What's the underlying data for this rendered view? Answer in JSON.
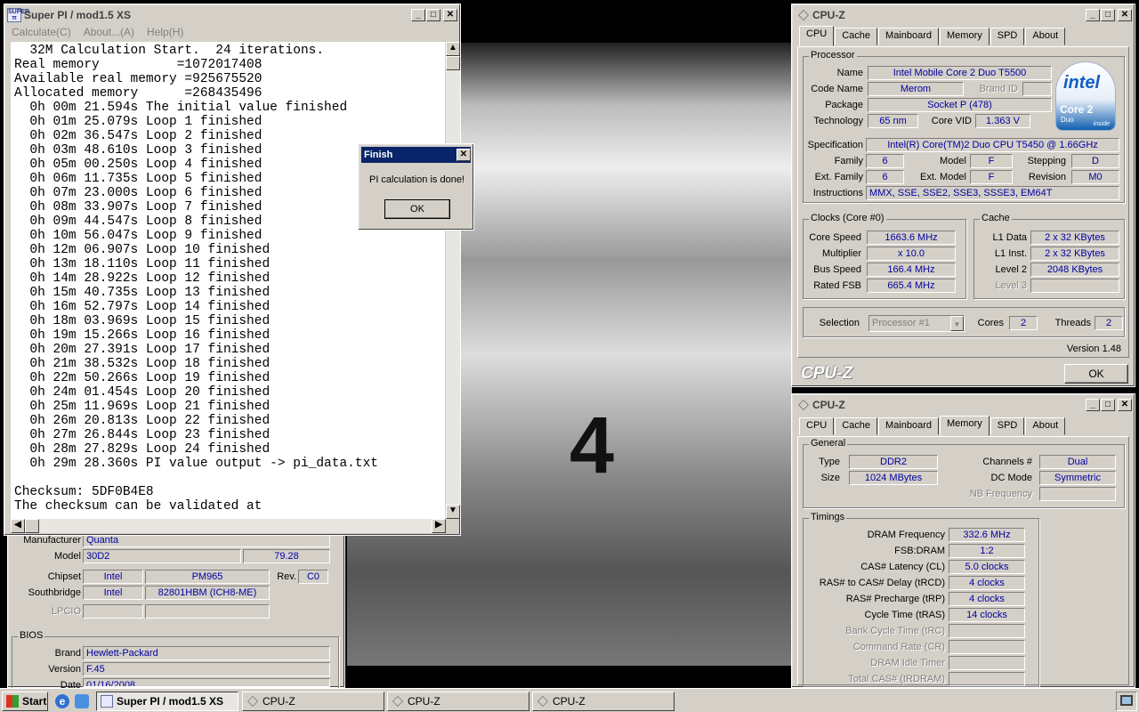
{
  "superpi": {
    "title": "Super PI / mod1.5 XS",
    "menu": [
      "Calculate(C)",
      "About...(A)",
      "Help(H)"
    ],
    "console_lines": [
      "  32M Calculation Start.  24 iterations.",
      "Real memory          =1072017408",
      "Available real memory =925675520",
      "Allocated memory      =268435496",
      "  0h 00m 21.594s The initial value finished",
      "  0h 01m 25.079s Loop 1 finished",
      "  0h 02m 36.547s Loop 2 finished",
      "  0h 03m 48.610s Loop 3 finished",
      "  0h 05m 00.250s Loop 4 finished",
      "  0h 06m 11.735s Loop 5 finished",
      "  0h 07m 23.000s Loop 6 finished",
      "  0h 08m 33.907s Loop 7 finished",
      "  0h 09m 44.547s Loop 8 finished",
      "  0h 10m 56.047s Loop 9 finished",
      "  0h 12m 06.907s Loop 10 finished",
      "  0h 13m 18.110s Loop 11 finished",
      "  0h 14m 28.922s Loop 12 finished",
      "  0h 15m 40.735s Loop 13 finished",
      "  0h 16m 52.797s Loop 14 finished",
      "  0h 18m 03.969s Loop 15 finished",
      "  0h 19m 15.266s Loop 16 finished",
      "  0h 20m 27.391s Loop 17 finished",
      "  0h 21m 38.532s Loop 18 finished",
      "  0h 22m 50.266s Loop 19 finished",
      "  0h 24m 01.454s Loop 20 finished",
      "  0h 25m 11.969s Loop 21 finished",
      "  0h 26m 20.813s Loop 22 finished",
      "  0h 27m 26.844s Loop 23 finished",
      "  0h 28m 27.829s Loop 24 finished",
      "  0h 29m 28.360s PI value output -> pi_data.txt",
      "",
      "Checksum: 5DF0B4E8",
      "The checksum can be validated at"
    ]
  },
  "finish_dialog": {
    "title": "Finish",
    "message": "PI calculation is done!",
    "ok": "OK"
  },
  "cpuz_mb": {
    "manufacturer_label": "Manufacturer",
    "manufacturer": "Quanta",
    "model_label": "Model",
    "model": "30D2",
    "model_rev": "79.28",
    "chipset_label": "Chipset",
    "chipset_vendor": "Intel",
    "chipset_name": "PM965",
    "rev_label": "Rev.",
    "chipset_rev": "C0",
    "southbridge_label": "Southbridge",
    "sb_vendor": "Intel",
    "sb_name": "82801HBM (ICH8-ME)",
    "lpcio_label": "LPCIO",
    "bios_title": "BIOS",
    "brand_label": "Brand",
    "brand": "Hewlett-Packard",
    "version_label": "Version",
    "version": "F.45",
    "date_label": "Date",
    "date": "01/16/2008"
  },
  "cpuz_cpu": {
    "title": "CPU-Z",
    "tabs": [
      "CPU",
      "Cache",
      "Mainboard",
      "Memory",
      "SPD",
      "About"
    ],
    "processor_title": "Processor",
    "name_label": "Name",
    "name": "Intel Mobile Core 2 Duo T5500",
    "codename_label": "Code Name",
    "codename": "Merom",
    "brandid_label": "Brand ID",
    "package_label": "Package",
    "package": "Socket P (478)",
    "technology_label": "Technology",
    "technology": "65 nm",
    "corevid_label": "Core VID",
    "corevid": "1.363 V",
    "spec_label": "Specification",
    "spec": "Intel(R) Core(TM)2 Duo CPU     T5450  @ 1.66GHz",
    "family_label": "Family",
    "family": "6",
    "model_label": "Model",
    "model": "F",
    "stepping_label": "Stepping",
    "stepping": "D",
    "extfamily_label": "Ext. Family",
    "extfamily": "6",
    "extmodel_label": "Ext. Model",
    "extmodel": "F",
    "revision_label": "Revision",
    "revision": "M0",
    "instr_label": "Instructions",
    "instr": "MMX, SSE, SSE2, SSE3, SSSE3, EM64T",
    "clocks_title": "Clocks (Core #0)",
    "corespeed_label": "Core Speed",
    "corespeed": "1663.6 MHz",
    "multiplier_label": "Multiplier",
    "multiplier": "x 10.0",
    "busspeed_label": "Bus Speed",
    "busspeed": "166.4 MHz",
    "ratedfsb_label": "Rated FSB",
    "ratedfsb": "665.4 MHz",
    "cache_title": "Cache",
    "l1d_label": "L1 Data",
    "l1d": "2 x 32 KBytes",
    "l1i_label": "L1 Inst.",
    "l1i": "2 x 32 KBytes",
    "l2_label": "Level 2",
    "l2": "2048 KBytes",
    "l3_label": "Level 3",
    "selection_label": "Selection",
    "selection": "Processor #1",
    "cores_label": "Cores",
    "cores": "2",
    "threads_label": "Threads",
    "threads": "2",
    "version": "Version 1.48",
    "logo": "CPU-Z",
    "ok": "OK",
    "intel_logo": "intel",
    "core2_logo": "Core 2",
    "duo_logo": "Duo",
    "inside_logo": "inside"
  },
  "cpuz_mem": {
    "title": "CPU-Z",
    "tabs": [
      "CPU",
      "Cache",
      "Mainboard",
      "Memory",
      "SPD",
      "About"
    ],
    "general_title": "General",
    "type_label": "Type",
    "type": "DDR2",
    "channels_label": "Channels #",
    "channels": "Dual",
    "size_label": "Size",
    "size": "1024 MBytes",
    "dcmode_label": "DC Mode",
    "dcmode": "Symmetric",
    "nbfreq_label": "NB Frequency",
    "timings_title": "Timings",
    "dram_freq_label": "DRAM Frequency",
    "dram_freq": "332.6 MHz",
    "fsbdram_label": "FSB:DRAM",
    "fsbdram": "1:2",
    "cas_label": "CAS# Latency (CL)",
    "cas": "5.0 clocks",
    "trcd_label": "RAS# to CAS# Delay (tRCD)",
    "trcd": "4 clocks",
    "trp_label": "RAS# Precharge (tRP)",
    "trp": "4 clocks",
    "tras_label": "Cycle Time (tRAS)",
    "tras": "14 clocks",
    "trc_label": "Bank Cycle Time (tRC)",
    "cr_label": "Command Rate (CR)",
    "idle_label": "DRAM Idle Timer",
    "trdram_label": "Total CAS# (tRDRAM)"
  },
  "taskbar": {
    "start": "Start",
    "tasks": [
      "Super PI / mod1.5 XS",
      "CPU-Z",
      "CPU-Z",
      "CPU-Z"
    ]
  },
  "colors": {
    "titlebar_active": "#0a246a",
    "value_text": "#0000a0",
    "window_face": "#d4d0c8"
  }
}
